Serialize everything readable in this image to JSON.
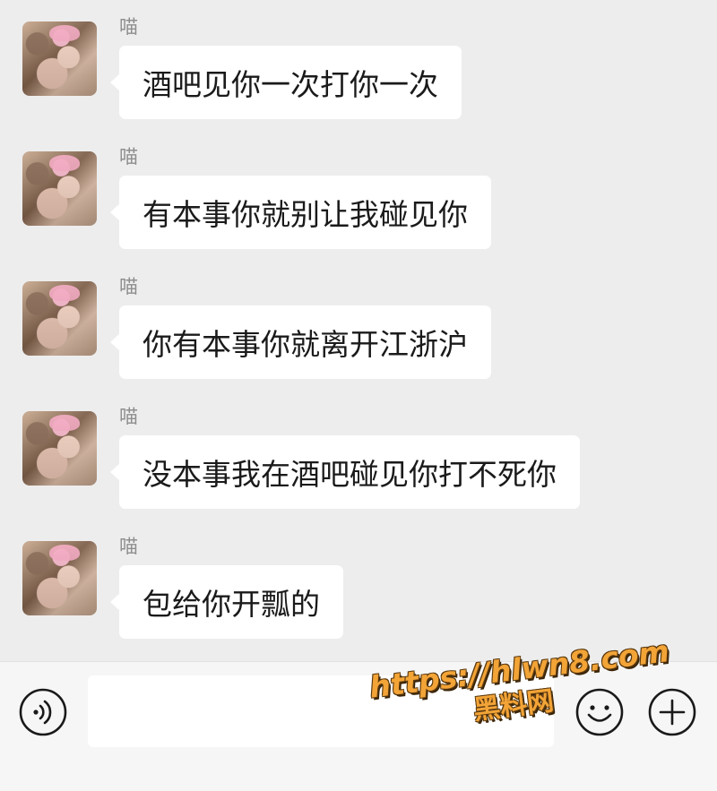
{
  "messages": [
    {
      "sender": "喵",
      "text": "酒吧见你一次打你一次"
    },
    {
      "sender": "喵",
      "text": "有本事你就别让我碰见你"
    },
    {
      "sender": "喵",
      "text": "你有本事你就离开江浙沪"
    },
    {
      "sender": "喵",
      "text": "没本事我在酒吧碰见你打不死你"
    },
    {
      "sender": "喵",
      "text": "包给你开瓢的"
    }
  ],
  "input_bar": {
    "message_value": "",
    "voice_icon": "voice-icon",
    "emoji_icon": "emoji-icon",
    "add_icon": "plus-circle-icon"
  },
  "watermark": {
    "url": "https://hlwn8.com",
    "name": "黑料网"
  },
  "colors": {
    "chat_background": "#ededed",
    "bubble": "#ffffff",
    "sender_name": "#8e8e8e",
    "watermark": "#f3a437"
  }
}
